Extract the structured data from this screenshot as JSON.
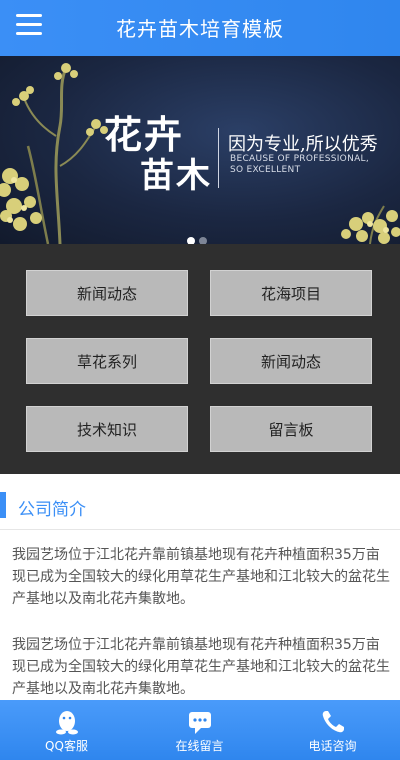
{
  "header": {
    "title": "花卉苗木培育模板",
    "menu_icon": "hamburger-menu-icon"
  },
  "banner": {
    "big_line1": "花卉",
    "big_line2": "苗木",
    "slogan": "因为专业,所以优秀",
    "english_line1": "BECAUSE OF PROFESSIONAL,",
    "english_line2": "SO EXCELLENT",
    "active_slide": 1,
    "slide_count": 2
  },
  "nav_buttons": [
    "新闻动态",
    "花海项目",
    "草花系列",
    "新闻动态",
    "技术知识",
    "留言板"
  ],
  "section": {
    "title": "公司简介"
  },
  "paragraphs": [
    "我园艺场位于江北花卉靠前镇基地现有花卉种植面积35万亩现已成为全国较大的绿化用草花生产基地和江北较大的盆花生产基地以及南北花卉集散地。",
    "我园艺场位于江北花卉靠前镇基地现有花卉种植面积35万亩现已成为全国较大的绿化用草花生产基地和江北较大的盆花生产基地以及南北花卉集散地。"
  ],
  "bottom_nav": [
    {
      "label": "QQ客服",
      "icon": "qq-penguin-icon"
    },
    {
      "label": "在线留言",
      "icon": "chat-bubble-icon"
    },
    {
      "label": "电话咨询",
      "icon": "phone-icon"
    }
  ],
  "colors": {
    "primary": "#3b8ff6",
    "grid_bg": "#2f2f2f",
    "button_bg": "#b9b9b9"
  }
}
